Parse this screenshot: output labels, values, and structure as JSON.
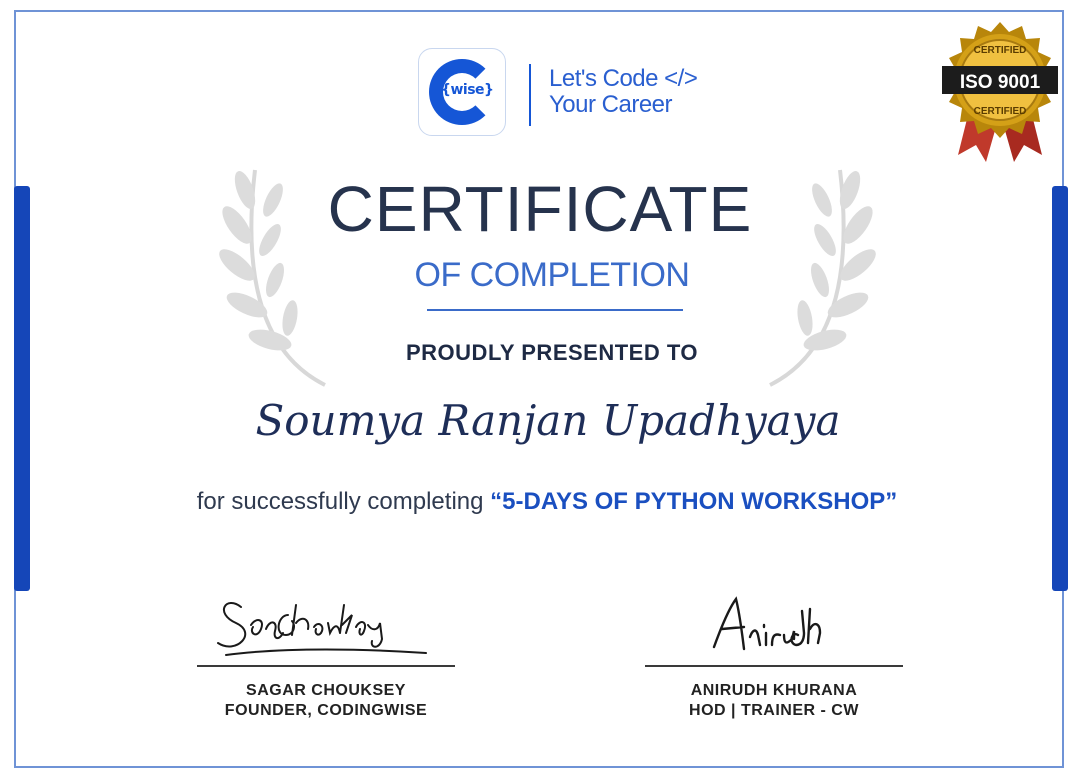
{
  "brand": {
    "logo_text": "{wise}",
    "tagline_line1": "Let's Code </>",
    "tagline_line2": "Your Career",
    "accent_color": "#1556d6"
  },
  "badge": {
    "top_text": "CERTIFIED",
    "main_text": "ISO 9001",
    "bottom_text": "CERTIFIED"
  },
  "certificate": {
    "title": "CERTIFICATE",
    "subtitle": "OF COMPLETION",
    "presented_label": "PROUDLY PRESENTED TO",
    "recipient": "Soumya Ranjan Upadhyaya",
    "statement_prefix": "for successfully completing ",
    "course": "“5-DAYS OF PYTHON WORKSHOP”"
  },
  "signatures": [
    {
      "signature_text": "SagarChouksey",
      "name": "SAGAR CHOUKSEY",
      "role": "FOUNDER, CODINGWISE"
    },
    {
      "signature_text": "Anirudh",
      "name": "ANIRUDH KHURANA",
      "role": "HOD | TRAINER - CW"
    }
  ]
}
